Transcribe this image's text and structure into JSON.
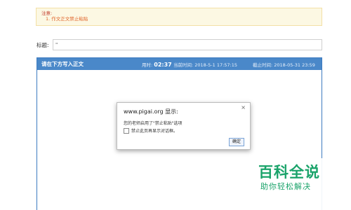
{
  "notice": {
    "heading": "注意:",
    "items": [
      "1. 作文正文禁止粘贴"
    ]
  },
  "title_field": {
    "label": "标题:",
    "value": "\""
  },
  "editor": {
    "header": "请在下方写入正文",
    "elapsed_label": "用时:",
    "elapsed_value": "02:37",
    "current_time": "当前时间: 2018-5-1 17:57:15",
    "deadline": "截止时间: 2018-05-31 23:59"
  },
  "dialog": {
    "title": "www.pigai.org 显示:",
    "close_glyph": "×",
    "message": "您的老师启用了\"禁止粘贴\"选项",
    "checkbox_label": "禁止此页再显示对话框。",
    "ok_label": "确定"
  },
  "watermark": {
    "title": "百科全说",
    "subtitle": "助你轻松解决"
  },
  "colors": {
    "editor_header": "#4a88c9",
    "notice_bg": "#fcf8e3",
    "brand_green": "#1aa36a"
  }
}
